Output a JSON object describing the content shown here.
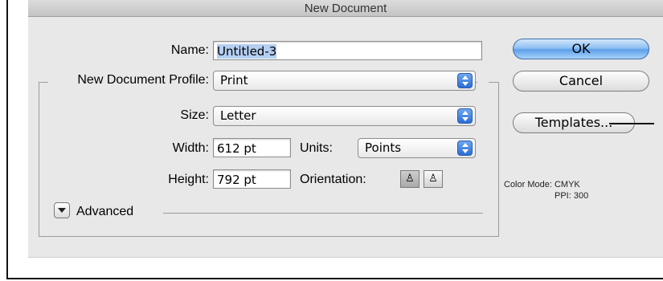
{
  "dialog": {
    "title": "New Document",
    "name_label": "Name:",
    "name_value": "Untitled-3",
    "profile_label": "New Document Profile:",
    "profile_value": "Print",
    "size_label": "Size:",
    "size_value": "Letter",
    "width_label": "Width:",
    "width_value": "612 pt",
    "units_label": "Units:",
    "units_value": "Points",
    "height_label": "Height:",
    "height_value": "792 pt",
    "orientation_label": "Orientation:",
    "orientation_portrait_icon": "portrait-orientation-icon",
    "orientation_landscape_icon": "landscape-orientation-icon",
    "advanced_label": "Advanced"
  },
  "buttons": {
    "ok": "OK",
    "cancel": "Cancel",
    "templates": "Templates..."
  },
  "info": {
    "color_mode": "Color Mode: CMYK",
    "ppi": "PPI: 300"
  }
}
